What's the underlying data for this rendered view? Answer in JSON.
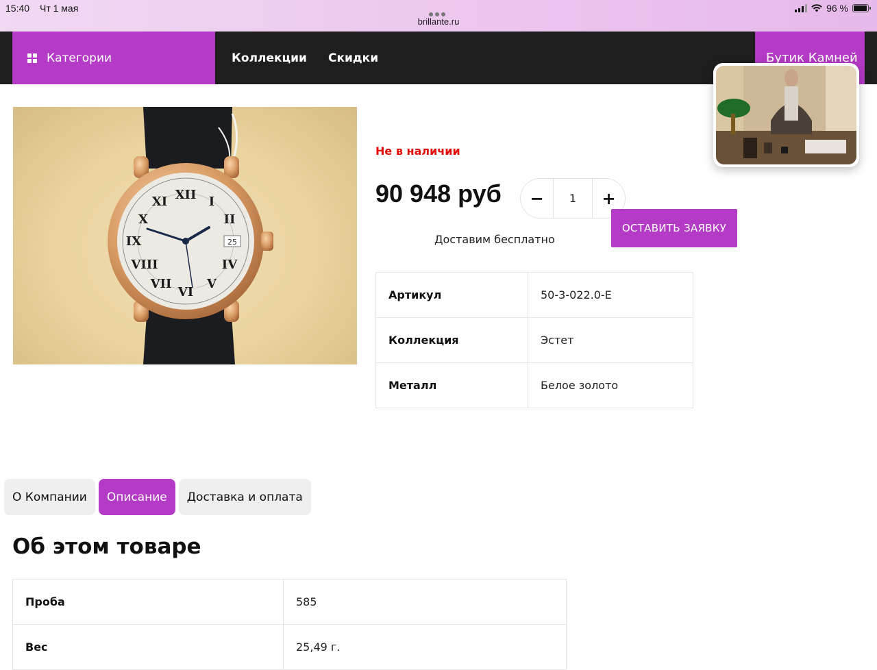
{
  "status_bar": {
    "time": "15:40",
    "date": "Чт 1 мая",
    "url": "brillante.ru",
    "battery": "96 %"
  },
  "nav": {
    "categories": "Категории",
    "collections": "Коллекции",
    "discounts": "Скидки",
    "boutique": "Бутик Камней"
  },
  "product": {
    "stock_status": "Не в наличии",
    "price": "90 948 руб",
    "quantity": "1",
    "minus": "−",
    "plus": "+",
    "order_button": "ОСТАВИТЬ ЗАЯВКУ",
    "delivery": "Доставим бесплатно"
  },
  "specs": [
    {
      "key": "Артикул",
      "value": "50-3-022.0-E"
    },
    {
      "key": "Коллекция",
      "value": "Эстет"
    },
    {
      "key": "Металл",
      "value": "Белое золото"
    }
  ],
  "tabs": [
    {
      "label": "О Компании"
    },
    {
      "label": "Описание",
      "active": true
    },
    {
      "label": "Доставка и оплата"
    }
  ],
  "about": {
    "title": "Об этом товаре",
    "rows": [
      {
        "key": "Проба",
        "value": "585"
      },
      {
        "key": "Вес",
        "value": "25,49 г."
      }
    ]
  },
  "colors": {
    "accent": "#b43bc5",
    "nav_bg": "#1e1e1e",
    "out_of_stock": "#e30b0b"
  }
}
